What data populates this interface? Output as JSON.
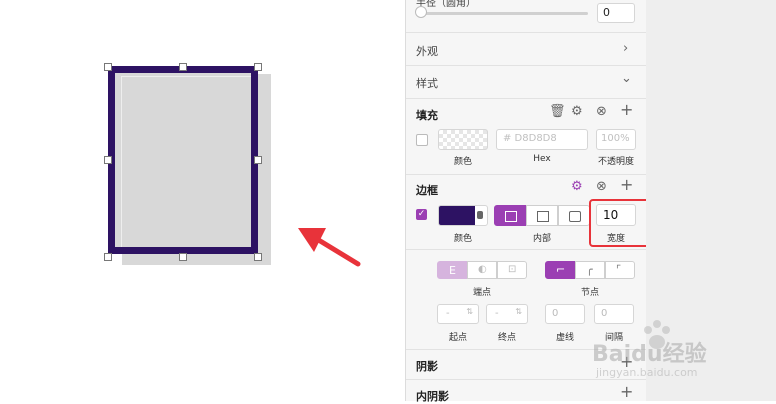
{
  "panel": {
    "radius": {
      "label": "半径（圆角）",
      "value": "0"
    },
    "appearance": {
      "label": "外观"
    },
    "style": {
      "label": "样式"
    },
    "fill": {
      "label": "填充",
      "hex_placeholder": "# D8D8D8",
      "opacity_placeholder": "100%",
      "color_label": "颜色",
      "hex_label": "Hex",
      "opacity_label": "不透明度"
    },
    "border": {
      "label": "边框",
      "color": "#2d1263",
      "width_value": "10",
      "color_label": "颜色",
      "position_label": "内部",
      "width_label": "宽度"
    },
    "ends": {
      "label": "端点"
    },
    "joins": {
      "label": "节点"
    },
    "start_value": "-",
    "end_value": "-",
    "dash_value": "0",
    "gap_value": "0",
    "start_label": "起点",
    "end_label": "终点",
    "dash_label": "虚线",
    "gap_label": "间隔",
    "shadow": {
      "label": "阴影"
    },
    "inner_shadow": {
      "label": "内阴影"
    }
  },
  "watermark": {
    "brand": "Baidu经验",
    "url": "jingyan.baidu.com"
  },
  "colors": {
    "accent": "#9b3fb3",
    "annotation": "#e8333a",
    "shape_fill": "#d8d8d8",
    "shape_border": "#2d1263"
  }
}
